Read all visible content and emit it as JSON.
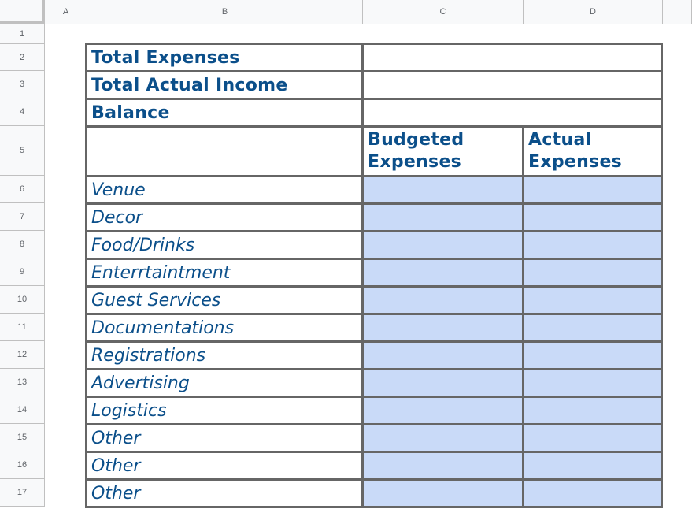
{
  "columns": [
    "A",
    "B",
    "C",
    "D"
  ],
  "rows": [
    "1",
    "2",
    "3",
    "4",
    "5",
    "6",
    "7",
    "8",
    "9",
    "10",
    "11",
    "12",
    "13",
    "14",
    "15",
    "16",
    "17"
  ],
  "summary": {
    "total_expenses": "Total Expenses",
    "total_actual_income": "Total Actual Income",
    "balance": "Balance"
  },
  "headers": {
    "budgeted_line1": "Budgeted",
    "budgeted_line2": "Expenses",
    "actual_line1": "Actual",
    "actual_line2": "Expenses"
  },
  "categories": [
    "Venue",
    "Decor",
    "Food/Drinks",
    "Enterrtaintment",
    "Guest Services",
    "Documentations",
    "Registrations",
    "Advertising",
    "Logistics",
    "Other",
    "Other",
    "Other"
  ],
  "colors": {
    "header_text": "#0b4f8a",
    "input_fill": "#c9daf8",
    "border": "#666666"
  }
}
